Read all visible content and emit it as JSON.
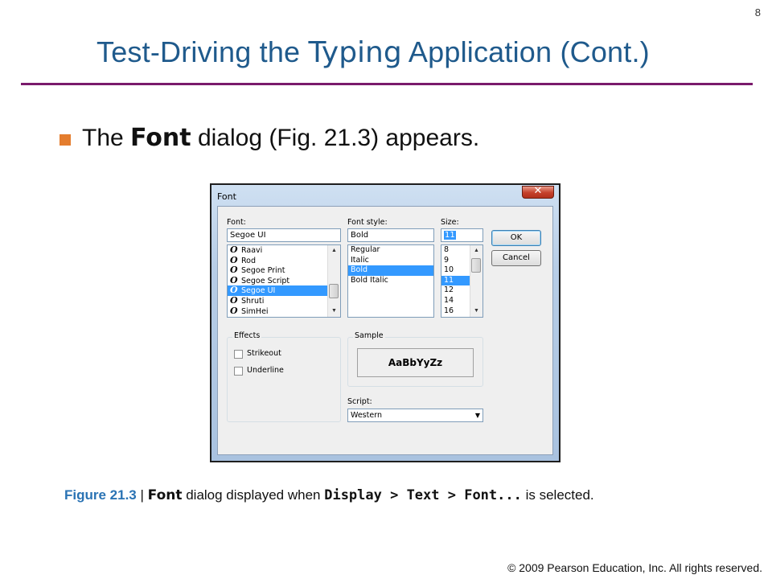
{
  "page_number": "8",
  "title": {
    "before": "Test-Driving the ",
    "app_name": "Typing",
    "after": " Application (Cont.)"
  },
  "bullet": {
    "before": "The ",
    "bold": "Font",
    "after": " dialog (Fig. 21.3) appears."
  },
  "dialog": {
    "title": "Font",
    "close_glyph": "✕",
    "font_label": "Font:",
    "font_value": "Segoe UI",
    "font_list": [
      "Raavi",
      "Rod",
      "Segoe Print",
      "Segoe Script",
      "Segoe UI",
      "Shruti",
      "SimHei"
    ],
    "font_selected_index": 4,
    "style_label": "Font style:",
    "style_value": "Bold",
    "style_list": [
      "Regular",
      "Italic",
      "Bold",
      "Bold Italic"
    ],
    "style_selected_index": 2,
    "size_label": "Size:",
    "size_value": "11",
    "size_list": [
      "8",
      "9",
      "10",
      "11",
      "12",
      "14",
      "16"
    ],
    "size_selected_index": 3,
    "ok_label": "OK",
    "cancel_label": "Cancel",
    "effects_label": "Effects",
    "strikeout_label": "Strikeout",
    "underline_label": "Underline",
    "sample_label": "Sample",
    "sample_text": "AaBbYyZz",
    "script_label": "Script:",
    "script_value": "Western"
  },
  "caption": {
    "figure": "Figure 21.3",
    "separator": " | ",
    "font_word": "Font",
    "middle": " dialog displayed when ",
    "menu_path": "Display > Text > Font...",
    "end": " is selected."
  },
  "footer": "© 2009 Pearson Education, Inc.  All rights reserved.",
  "colors": {
    "title": "#1f5a8c",
    "rule": "#7a1a6b",
    "bullet": "#e47d2e",
    "figure_label": "#2a73b4",
    "selection": "#3399ff"
  }
}
